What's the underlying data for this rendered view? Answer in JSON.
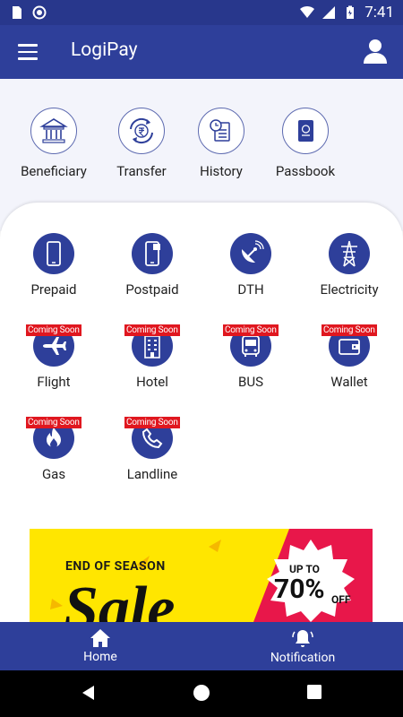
{
  "status_bar": {
    "time": "7:41",
    "battery_level": "80%"
  },
  "app": {
    "title": "LogiPay"
  },
  "quick_actions": [
    {
      "label": "Beneficiary",
      "icon": "bank-icon"
    },
    {
      "label": "Transfer",
      "icon": "rupee-transfer-icon"
    },
    {
      "label": "History",
      "icon": "history-icon"
    },
    {
      "label": "Passbook",
      "icon": "passbook-icon"
    }
  ],
  "services": [
    {
      "label": "Prepaid",
      "icon": "mobile-icon",
      "badge": ""
    },
    {
      "label": "Postpaid",
      "icon": "mobile-bill-icon",
      "badge": ""
    },
    {
      "label": "DTH",
      "icon": "satellite-dish-icon",
      "badge": ""
    },
    {
      "label": "Electricity",
      "icon": "electric-tower-icon",
      "badge": ""
    },
    {
      "label": "Flight",
      "icon": "airplane-icon",
      "badge": "Coming Soon"
    },
    {
      "label": "Hotel",
      "icon": "hotel-icon",
      "badge": "Coming Soon"
    },
    {
      "label": "BUS",
      "icon": "bus-icon",
      "badge": "Coming Soon"
    },
    {
      "label": "Wallet",
      "icon": "wallet-icon",
      "badge": "Coming Soon"
    },
    {
      "label": "Gas",
      "icon": "gas-flame-icon",
      "badge": "Coming Soon"
    },
    {
      "label": "Landline",
      "icon": "phone-icon",
      "badge": "Coming Soon"
    }
  ],
  "banner": {
    "heading": "END OF SEASON",
    "main": "Sale",
    "upto": "UP TO",
    "percent": "70%",
    "off": "OFF"
  },
  "bottom_nav": [
    {
      "label": "Home",
      "icon": "home-icon"
    },
    {
      "label": "Notification",
      "icon": "bell-icon"
    }
  ],
  "colors": {
    "primary": "#2e3f9a",
    "status_bar": "#28378c",
    "badge": "#e0171f",
    "banner_bg": "#ffe600"
  }
}
